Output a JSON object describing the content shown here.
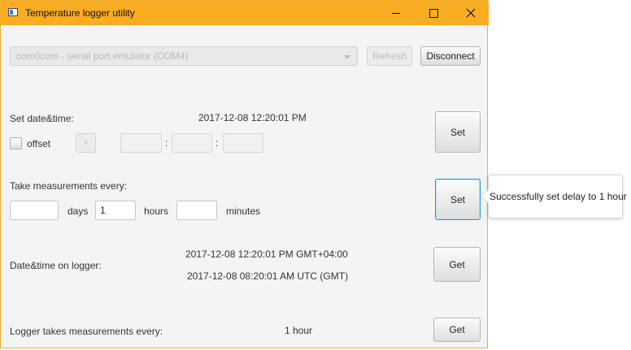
{
  "window": {
    "title": "Temperature logger utility",
    "accent_color": "#f8ad22"
  },
  "connection": {
    "port_selected": "com0com - serial port emulator (COM4)",
    "refresh_label": "Refresh",
    "disconnect_label": "Disconnect"
  },
  "set_datetime": {
    "label": "Set date&time:",
    "current_value": "2017-12-08 12:20:01 PM",
    "offset_label": "offset",
    "offset_checked": false,
    "plus_label": "+",
    "separator_1": ":",
    "separator_2": ":",
    "set_label": "Set"
  },
  "measurement_interval": {
    "label": "Take measurements every:",
    "days_value": "",
    "days_label": "days",
    "hours_value": "1",
    "hours_label": "hours",
    "minutes_value": "",
    "minutes_label": "minutes",
    "set_label": "Set"
  },
  "tooltip": {
    "text": "Successfully set delay to 1 hour"
  },
  "logger_datetime": {
    "label": "Date&time on logger:",
    "local_value": "2017-12-08 12:20:01 PM GMT+04:00",
    "utc_value": "2017-12-08 08:20:01 AM UTC (GMT)",
    "get_label": "Get"
  },
  "logger_interval": {
    "label": "Logger takes measurements every:",
    "value": "1 hour",
    "get_label": "Get"
  }
}
